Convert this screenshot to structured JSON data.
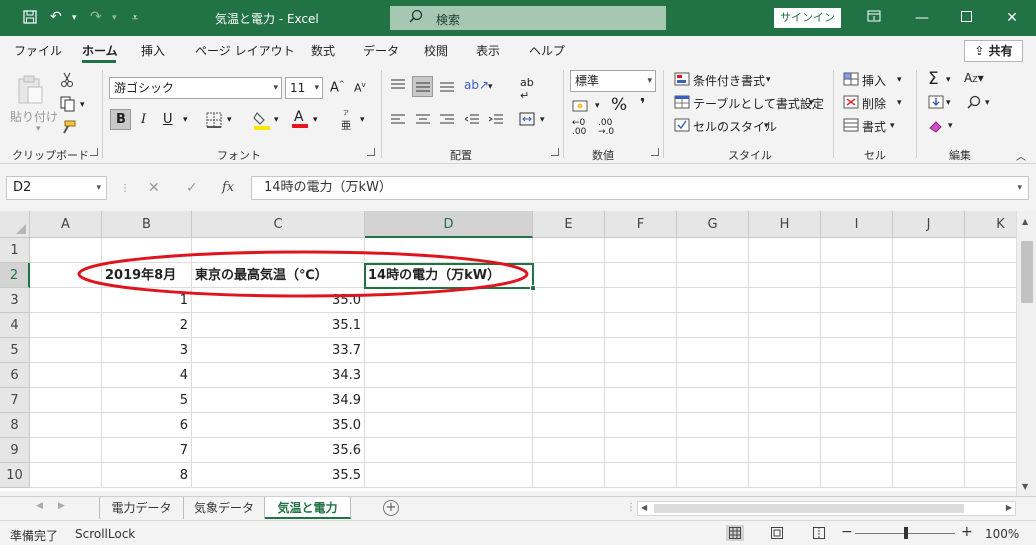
{
  "window": {
    "title": "気温と電力  -  Excel",
    "search_label": "検索",
    "signin_label": "サインイン"
  },
  "ribbon": {
    "tabs": [
      "ファイル",
      "ホーム",
      "挿入",
      "ページ レイアウト",
      "数式",
      "データ",
      "校閲",
      "表示",
      "ヘルプ"
    ],
    "active_tab": "ホーム",
    "share_label": "共有",
    "clipboard": {
      "paste_label": "貼り付け",
      "group_label": "クリップボード"
    },
    "font": {
      "name": "游ゴシック",
      "size": "11",
      "group_label": "フォント",
      "bold": "B",
      "italic": "I",
      "underline": "U",
      "phonetic_label": "亜"
    },
    "alignment": {
      "group_label": "配置"
    },
    "number": {
      "format": "標準",
      "percent": "%",
      "comma": "❜",
      "inc_decimal": ".00",
      "dec_decimal": ".00",
      "group_label": "数値"
    },
    "styles": {
      "conditional": "条件付き書式",
      "as_table": "テーブルとして書式設定",
      "cell_styles": "セルのスタイル",
      "group_label": "スタイル"
    },
    "cells": {
      "insert": "挿入",
      "delete": "削除",
      "format": "書式",
      "group_label": "セル"
    },
    "editing": {
      "group_label": "編集"
    }
  },
  "formula_bar": {
    "name_box": "D2",
    "fx": "fx",
    "content": "14時の電力（万kW）"
  },
  "grid": {
    "columns": [
      "A",
      "B",
      "C",
      "D",
      "E",
      "F",
      "G",
      "H",
      "I",
      "J",
      "K"
    ],
    "selected_column": "D",
    "selected_row": "2",
    "row_headers": [
      "1",
      "2",
      "3",
      "4",
      "5",
      "6",
      "7",
      "8",
      "9",
      "10"
    ],
    "header_row": {
      "b": "2019年8月",
      "c": "東京の最高気温（℃）",
      "d": "14時の電力（万kW）"
    },
    "data_rows": [
      {
        "b": "1",
        "c": "35.0"
      },
      {
        "b": "2",
        "c": "35.1"
      },
      {
        "b": "3",
        "c": "33.7"
      },
      {
        "b": "4",
        "c": "34.3"
      },
      {
        "b": "5",
        "c": "34.9"
      },
      {
        "b": "6",
        "c": "35.0"
      },
      {
        "b": "7",
        "c": "35.6"
      },
      {
        "b": "8",
        "c": "35.5"
      }
    ]
  },
  "sheets": {
    "tabs": [
      "電力データ",
      "気象データ",
      "気温と電力"
    ],
    "active": "気温と電力"
  },
  "status": {
    "ready": "準備完了",
    "scroll_lock": "ScrollLock",
    "zoom": "100%"
  },
  "colors": {
    "excel_green": "#217346",
    "annotation_red": "#e0141e"
  }
}
